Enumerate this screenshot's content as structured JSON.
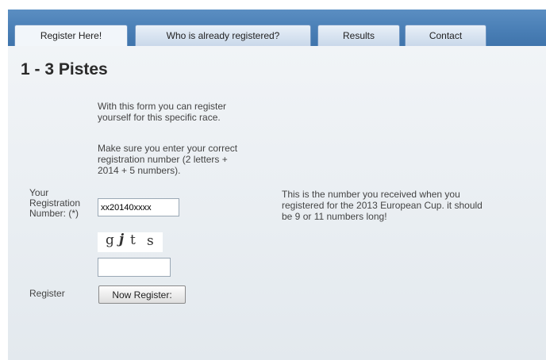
{
  "tabs": [
    {
      "label": "Register Here!",
      "active": true
    },
    {
      "label": "Who is already registered?",
      "active": false
    },
    {
      "label": "Results",
      "active": false
    },
    {
      "label": "Contact",
      "active": false
    }
  ],
  "page": {
    "title": "1 - 3 Pistes",
    "intro_lines": [
      "With this form you can register",
      "yourself for this specific race."
    ],
    "instruction_lines": [
      "Make sure you enter your correct",
      "registration number (2 letters +",
      "2014 + 5 numbers)."
    ]
  },
  "form": {
    "registration_label_lines": [
      "Your",
      "Registration",
      "Number: (*)"
    ],
    "registration_value": "xx20140xxxx",
    "registration_help_lines": [
      "This is the number you received when you",
      "registered for the 2013 European Cup. it should",
      "be 9 or 11 numbers long!"
    ],
    "captcha_chars": [
      "g",
      "j",
      "t",
      "s"
    ],
    "captcha_value": "",
    "submit_label": "Register",
    "submit_button": "Now Register:"
  },
  "colors": {
    "tabbar_blue": "#4a7fb6",
    "content_bg": "#e8eef4",
    "title_text": "#2a2a2a"
  }
}
